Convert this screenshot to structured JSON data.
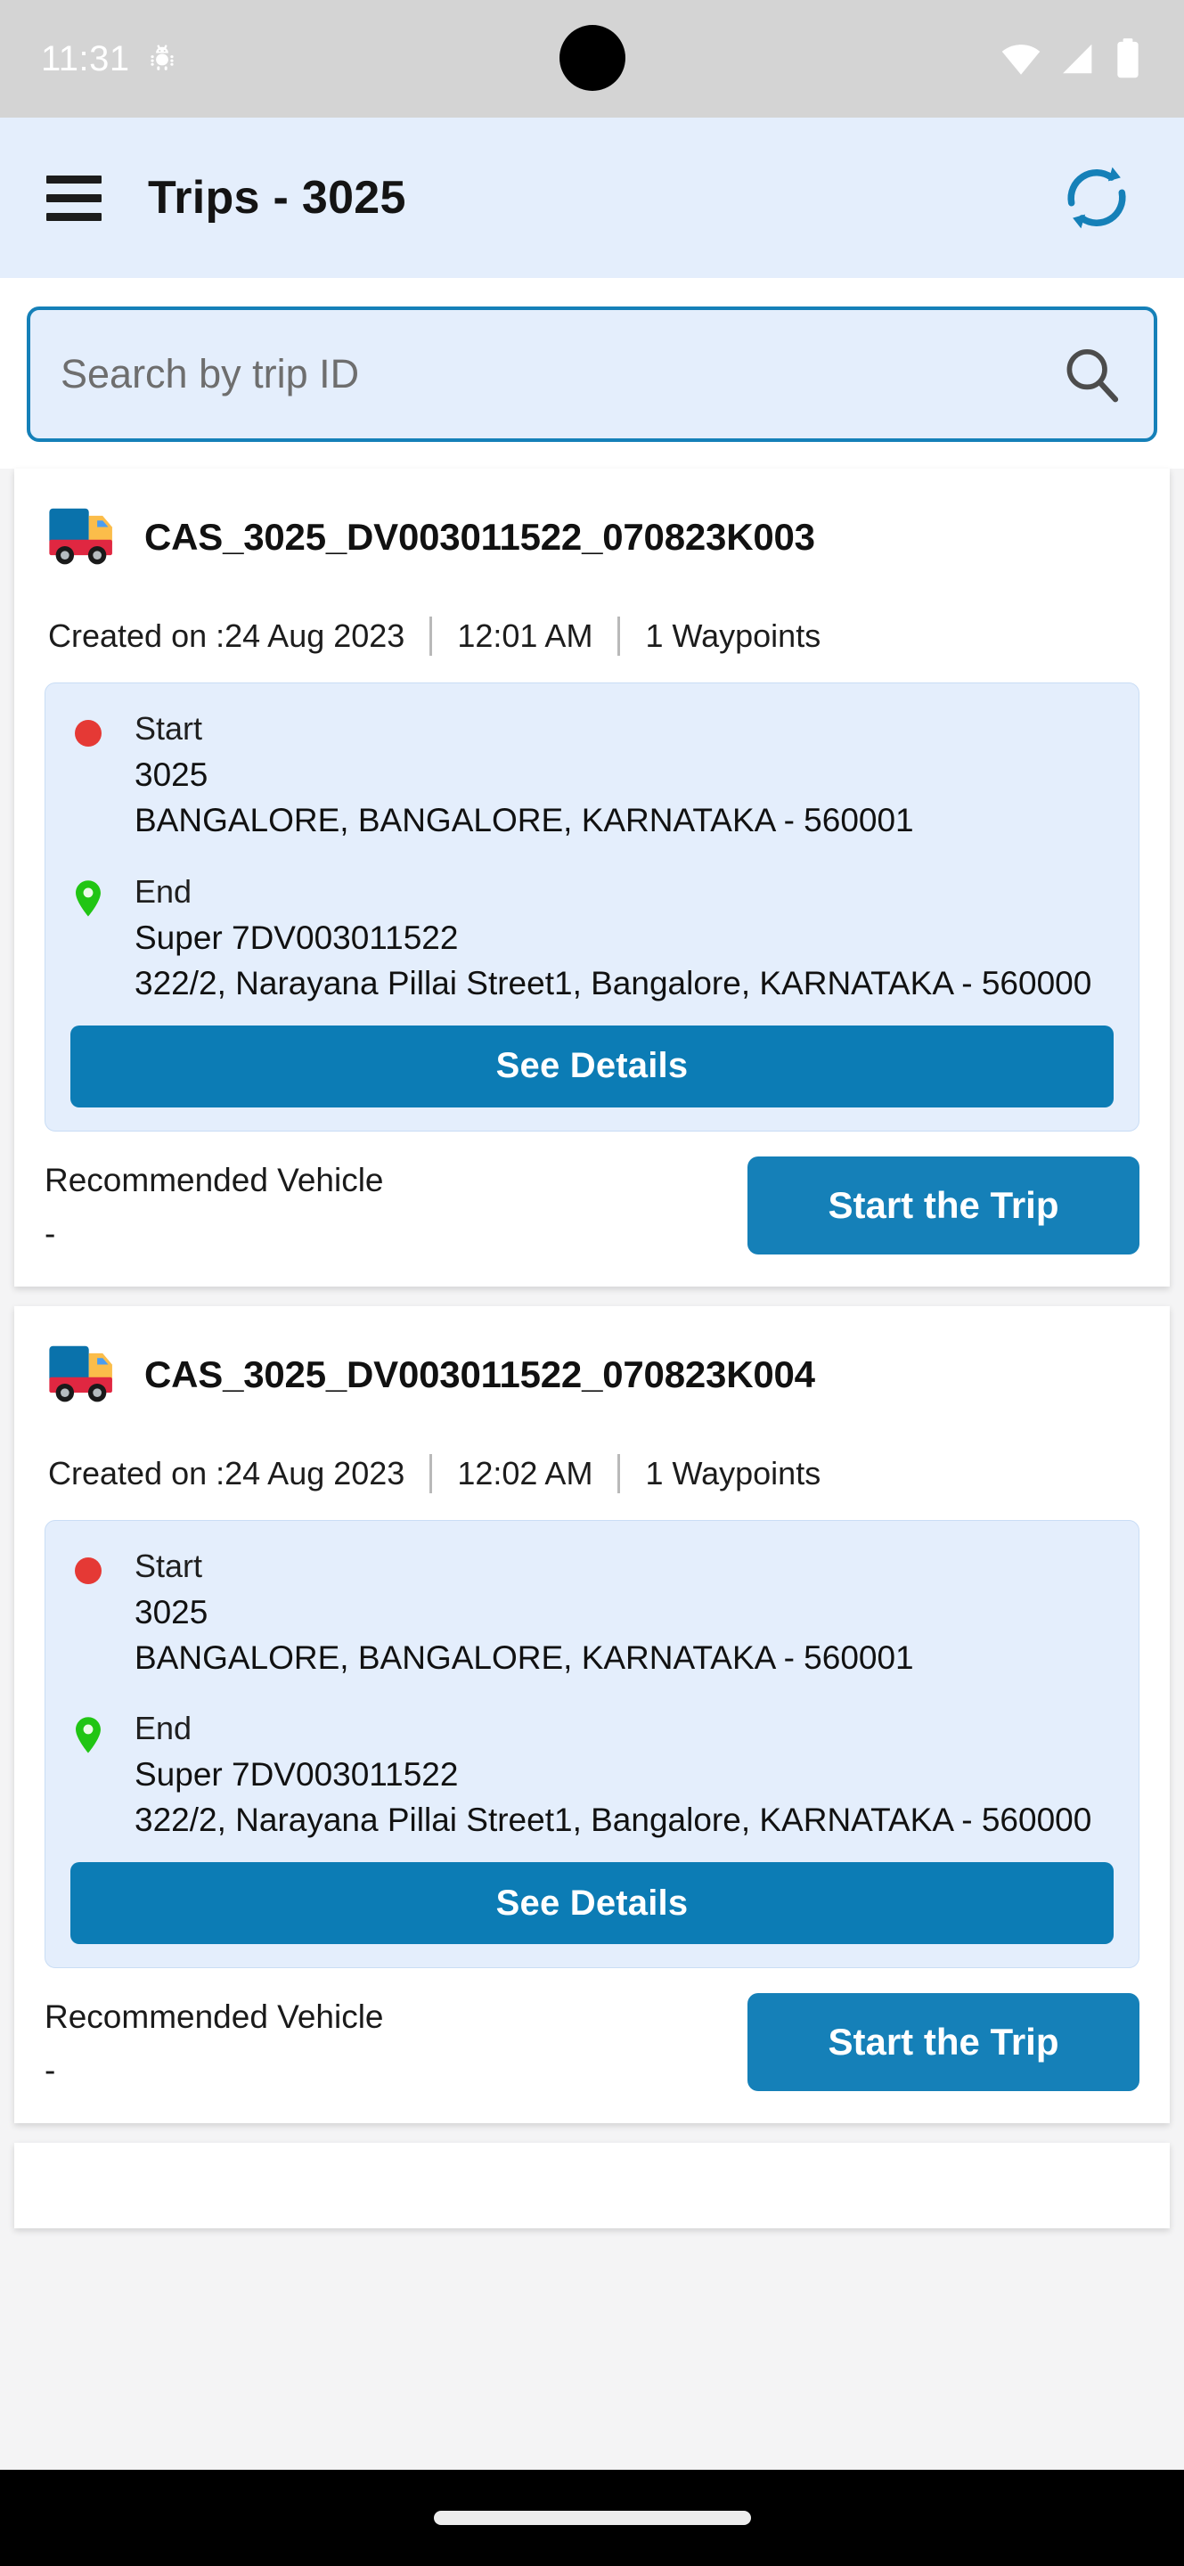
{
  "status_bar": {
    "time": "11:31",
    "icons": [
      "android-bug-icon",
      "wifi-icon",
      "cellular-signal-icon",
      "battery-icon"
    ]
  },
  "app_bar": {
    "menu_icon": "hamburger-menu-icon",
    "title": "Trips - 3025",
    "refresh_icon": "refresh-sync-icon",
    "background_color": "#e4eefc"
  },
  "search": {
    "value": "",
    "placeholder": "Search by trip ID",
    "icon": "search-icon",
    "border_color": "#1580b8"
  },
  "labels": {
    "created_on_prefix": "Created on : ",
    "start": "Start",
    "end": "End",
    "see_details": "See Details",
    "recommended_vehicle": "Recommended Vehicle",
    "start_the_trip": "Start the Trip"
  },
  "colors": {
    "primary_blue": "#1580b8",
    "details_button_blue": "#0c7cb5",
    "panel_blue": "#e4eefc",
    "start_marker_red": "#e53935",
    "end_marker_green": "#21c514",
    "page_background": "#f4f4f5"
  },
  "trips": [
    {
      "icon": "truck-icon",
      "trip_id": "CAS_3025_DV003011522_070823K003",
      "created_date": "24 Aug 2023",
      "created_time": "12:01 AM",
      "waypoints": "1 Waypoints",
      "start": {
        "label": "Start",
        "name": "3025",
        "address": "BANGALORE, BANGALORE, KARNATAKA - 560001"
      },
      "end": {
        "label": "End",
        "name": "Super 7DV003011522",
        "address": "322/2, Narayana Pillai Street1, Bangalore, KARNATAKA - 560000"
      },
      "see_details": "See Details",
      "recommended_vehicle_label": "Recommended Vehicle",
      "recommended_vehicle_value": "-",
      "start_trip": "Start the Trip"
    },
    {
      "icon": "truck-icon",
      "trip_id": "CAS_3025_DV003011522_070823K004",
      "created_date": "24 Aug 2023",
      "created_time": "12:02 AM",
      "waypoints": "1 Waypoints",
      "start": {
        "label": "Start",
        "name": "3025",
        "address": "BANGALORE, BANGALORE, KARNATAKA - 560001"
      },
      "end": {
        "label": "End",
        "name": "Super 7DV003011522",
        "address": "322/2, Narayana Pillai Street1, Bangalore, KARNATAKA - 560000"
      },
      "see_details": "See Details",
      "recommended_vehicle_label": "Recommended Vehicle",
      "recommended_vehicle_value": "-",
      "start_trip": "Start the Trip"
    }
  ],
  "nav_bar": {
    "gesture_pill": "home-gesture-pill"
  }
}
